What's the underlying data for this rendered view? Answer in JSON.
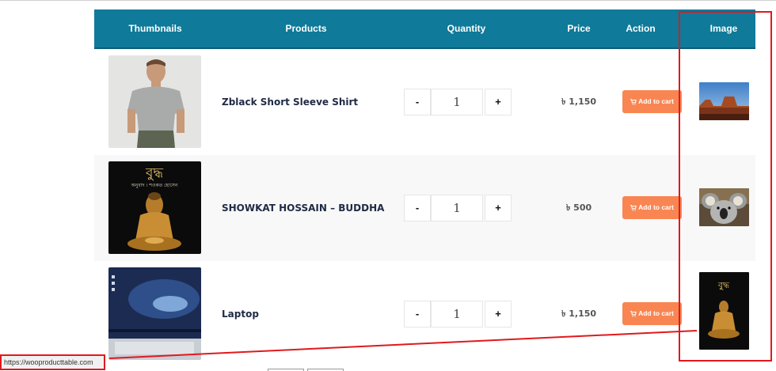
{
  "table": {
    "headers": {
      "thumbnails": "Thumbnails",
      "products": "Products",
      "quantity": "Quantity",
      "price": "Price",
      "action": "Action",
      "image": "Image"
    },
    "rows": [
      {
        "name": "Zblack Short Sleeve Shirt",
        "qty": "1",
        "price": "৳ 1,150",
        "action": "Add to cart",
        "thumb": "man-grey-tshirt-photo",
        "image": "desert-canyon-photo"
      },
      {
        "name": "SHOWKAT HOSSAIN – BUDDHA",
        "qty": "1",
        "price": "৳ 500",
        "action": "Add to cart",
        "thumb": "buddha-book-cover",
        "image": "koala-photo"
      },
      {
        "name": "Laptop",
        "qty": "1",
        "price": "৳ 1,150",
        "action": "Add to cart",
        "thumb": "laptop-photo",
        "image": "buddha-book-cover"
      }
    ],
    "qty_minus": "-",
    "qty_plus": "+",
    "book_title_bn": "বুদ্ধ",
    "book_sub_bn": "অনুবাদ । শওকত হোসেন"
  },
  "status_bar": {
    "url": "https://wooproducttable.com"
  },
  "colors": {
    "header_bg": "#0f7a99",
    "button_bg": "#f98652",
    "highlight": "#e0191d"
  }
}
